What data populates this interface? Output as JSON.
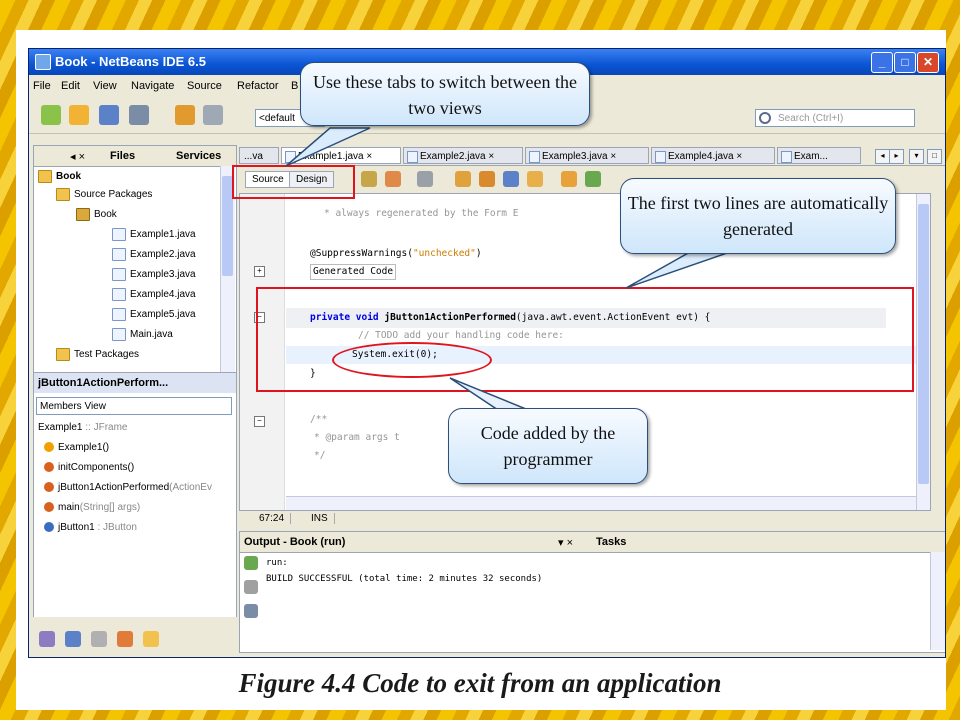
{
  "window": {
    "title": "Book - NetBeans IDE 6.5"
  },
  "menu": [
    "File",
    "Edit",
    "View",
    "Navigate",
    "Source",
    "Refactor",
    "B"
  ],
  "toolbar": {
    "config": "<default",
    "search_placeholder": "Search (Ctrl+I)"
  },
  "projects_panel": {
    "tabs": [
      "Files",
      "Services"
    ],
    "tree": [
      {
        "label": "Book",
        "type": "project"
      },
      {
        "label": "Source Packages",
        "type": "folder"
      },
      {
        "label": "Book",
        "type": "package"
      },
      {
        "label": "Example1.java",
        "type": "file"
      },
      {
        "label": "Example2.java",
        "type": "file"
      },
      {
        "label": "Example3.java",
        "type": "file"
      },
      {
        "label": "Example4.java",
        "type": "file"
      },
      {
        "label": "Example5.java",
        "type": "file"
      },
      {
        "label": "Main.java",
        "type": "file"
      },
      {
        "label": "Test Packages",
        "type": "folder"
      }
    ]
  },
  "navigator": {
    "title": "jButton1ActionPerform...",
    "view": "Members View",
    "items": [
      {
        "name": "Example1",
        "type": " :: JFrame",
        "color": "#7a8ea8"
      },
      {
        "name": "Example1()",
        "type": "",
        "color": "#f0a000"
      },
      {
        "name": "initComponents()",
        "type": "",
        "color": "#d9601f"
      },
      {
        "name": "jButton1ActionPerformed",
        "type": "(ActionEv",
        "color": "#d9601f"
      },
      {
        "name": "main",
        "type": "(String[] args)",
        "color": "#d9601f"
      },
      {
        "name": "jButton1",
        "type": " : JButton",
        "color": "#3c6cc2"
      }
    ]
  },
  "editor": {
    "tabs": [
      "...va",
      "Example1.java",
      "Example2.java",
      "Example3.java",
      "Example4.java",
      "Exam..."
    ],
    "views": {
      "source": "Source",
      "design": "Design"
    },
    "code": {
      "l1": "* always regenerated by the Form E",
      "l2a": "@SuppressWarnings(",
      "l2b": "\"unchecked\"",
      "l2c": ")",
      "l3": "Generated Code",
      "l4a": "private void ",
      "l4b": "jButton1ActionPerformed",
      "l4c": "(java.awt.event.ActionEvent evt) {",
      "l5": "// TODO add your handling code here:",
      "l6": "System.exit(0);",
      "l7": "}",
      "l8": "/**",
      "l9": "* @param args t",
      "l10": "*/"
    },
    "status": {
      "position": "67:24",
      "mode": "INS"
    }
  },
  "output": {
    "title": "Output - Book (run)",
    "tasks": "Tasks",
    "lines": [
      "run:",
      "BUILD SUCCESSFUL (total time: 2 minutes 32 seconds)"
    ]
  },
  "annotations": {
    "tabs_callout": "Use these tabs to switch between the two views",
    "generated_callout": "The first two lines are automatically generated",
    "added_callout": "Code added by the programmer"
  },
  "caption": "Figure 4.4 Code to exit from an application",
  "colors": {
    "annotation_red": "#e0141e",
    "titlebar_blue": "#0a55d4"
  }
}
